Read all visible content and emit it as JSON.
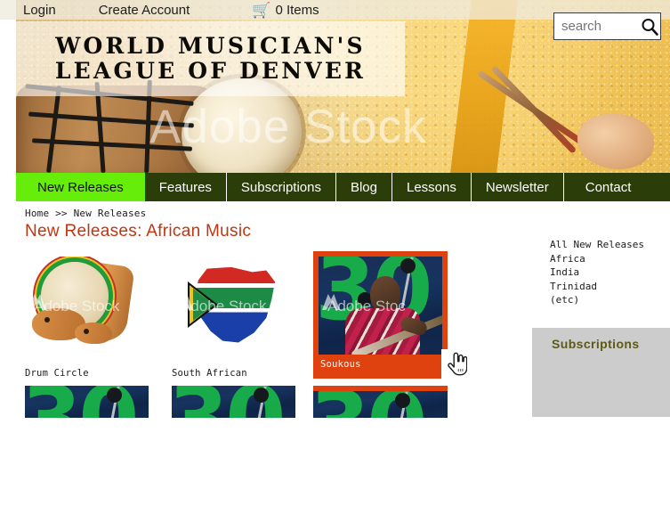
{
  "topbar": {
    "login_label": "Login",
    "create_account_label": "Create Account",
    "cart_icon": "shopping-cart-icon",
    "cart_label": "0 Items"
  },
  "branding": {
    "logo_line1": "WORLD MUSICIAN'S",
    "logo_line2": "LEAGUE OF DENVER",
    "banner_watermark": "Adobe Stock"
  },
  "search": {
    "value": "",
    "placeholder": "search",
    "icon": "magnifier-icon"
  },
  "nav": {
    "items": [
      {
        "label": "New Releases",
        "active": true
      },
      {
        "label": "Features",
        "active": false
      },
      {
        "label": "Subscriptions",
        "active": false
      },
      {
        "label": "Blog",
        "active": false
      },
      {
        "label": "Lessons",
        "active": false
      },
      {
        "label": "Newsletter",
        "active": false
      },
      {
        "label": "Contact",
        "active": false
      }
    ],
    "active_background": "#66ee0a",
    "background": "#2b3d09"
  },
  "breadcrumb": {
    "text": "Home >> New Releases"
  },
  "page": {
    "title": "New Releases: African Music",
    "title_color": "#c33410"
  },
  "catalog": {
    "row1": [
      {
        "label": "Drum Circle",
        "art": "drum-circle",
        "selected": false,
        "watermark": "Adobe Stock"
      },
      {
        "label": "South African",
        "art": "south-africa-flag-map",
        "selected": false,
        "watermark": "Adobe Stock"
      },
      {
        "label": "Soukous",
        "art": "soukous-musician",
        "selected": true,
        "watermark": "Adobe Stoc"
      }
    ],
    "row2_cut_off": [
      {
        "art": "soukous-musician"
      },
      {
        "art": "soukous-musician"
      },
      {
        "art": "soukous-musician"
      }
    ],
    "selection_color": "#e0420f"
  },
  "cursor": {
    "icon": "pointing-hand-cursor"
  },
  "sidebar": {
    "links": [
      {
        "label": "All New Releases"
      },
      {
        "label": "Africa"
      },
      {
        "label": "India"
      },
      {
        "label": "Trinidad"
      },
      {
        "label": "(etc)"
      }
    ],
    "subscriptions_box": {
      "title": "Subscriptions",
      "background": "#cccccc",
      "title_color": "#5b5a18"
    }
  }
}
